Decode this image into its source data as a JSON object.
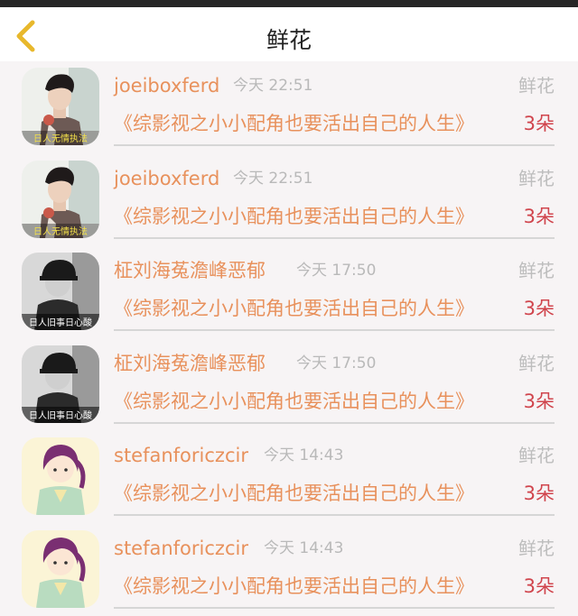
{
  "header": {
    "title": "鲜花",
    "back_icon": "chevron-left-icon",
    "accent": "#e8b82c"
  },
  "colors": {
    "name": "#e8915c",
    "time": "#b9b9b9",
    "count": "#d0454d",
    "tag": "#bdbdbd"
  },
  "items": [
    {
      "name": "joeiboxferd",
      "time": "今天 22:51",
      "tag": "鲜花",
      "book": "《综影视之小小配角也要活出自己的人生》",
      "count": "3朵",
      "avatar_caption": "日人无情执法"
    },
    {
      "name": "joeiboxferd",
      "time": "今天 22:51",
      "tag": "鲜花",
      "book": "《综影视之小小配角也要活出自己的人生》",
      "count": "3朵",
      "avatar_caption": "日人无情执法"
    },
    {
      "name": "柾刘海菟澹峰恶郁",
      "time": "今天 17:50",
      "tag": "鲜花",
      "book": "《综影视之小小配角也要活出自己的人生》",
      "count": "3朵",
      "avatar_caption": "日人旧事日心酸"
    },
    {
      "name": "柾刘海菟澹峰恶郁",
      "time": "今天 17:50",
      "tag": "鲜花",
      "book": "《综影视之小小配角也要活出自己的人生》",
      "count": "3朵",
      "avatar_caption": "日人旧事日心酸"
    },
    {
      "name": "stefanforiczcir",
      "time": "今天 14:43",
      "tag": "鲜花",
      "book": "《综影视之小小配角也要活出自己的人生》",
      "count": "3朵",
      "avatar_caption": ""
    },
    {
      "name": "stefanforiczcir",
      "time": "今天 14:43",
      "tag": "鲜花",
      "book": "《综影视之小小配角也要活出自己的人生》",
      "count": "3朵",
      "avatar_caption": ""
    }
  ]
}
